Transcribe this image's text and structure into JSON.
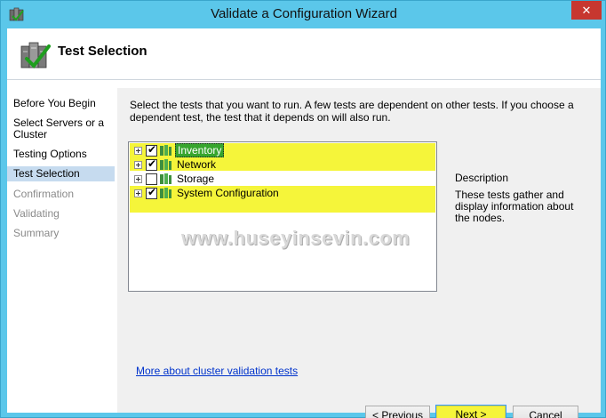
{
  "window": {
    "title": "Validate a Configuration Wizard",
    "close_glyph": "✕"
  },
  "header": {
    "title": "Test Selection",
    "icon": "validation-checklist-icon"
  },
  "nav": {
    "items": [
      {
        "label": "Before You Begin",
        "state": "normal"
      },
      {
        "label": "Select Servers or a Cluster",
        "state": "normal"
      },
      {
        "label": "Testing Options",
        "state": "normal"
      },
      {
        "label": "Test Selection",
        "state": "active"
      },
      {
        "label": "Confirmation",
        "state": "disabled"
      },
      {
        "label": "Validating",
        "state": "disabled"
      },
      {
        "label": "Summary",
        "state": "disabled"
      }
    ]
  },
  "main": {
    "intro": "Select the tests that you want to run.  A few tests are dependent on other tests.  If you choose a dependent test, the test that it depends on will also run.",
    "tests": [
      {
        "label": "Inventory",
        "checked": true,
        "selected": true,
        "highlighted": true
      },
      {
        "label": "Network",
        "checked": true,
        "selected": false,
        "highlighted": true
      },
      {
        "label": "Storage",
        "checked": false,
        "selected": false,
        "highlighted": false
      },
      {
        "label": "System Configuration",
        "checked": true,
        "selected": false,
        "highlighted": true
      }
    ],
    "watermark": "www.huseyinsevin.com",
    "description_title": "Description",
    "description_text": "These tests gather and display information about the nodes.",
    "more_link": "More about cluster validation tests"
  },
  "buttons": {
    "previous": "< Previous",
    "next": "Next >",
    "cancel": "Cancel"
  },
  "colors": {
    "frame": "#5bc7ea",
    "highlight": "#f5f53a",
    "selection": "#37a52e",
    "nav_active": "#c6dbef",
    "link": "#0033cc",
    "close": "#c7372f"
  }
}
